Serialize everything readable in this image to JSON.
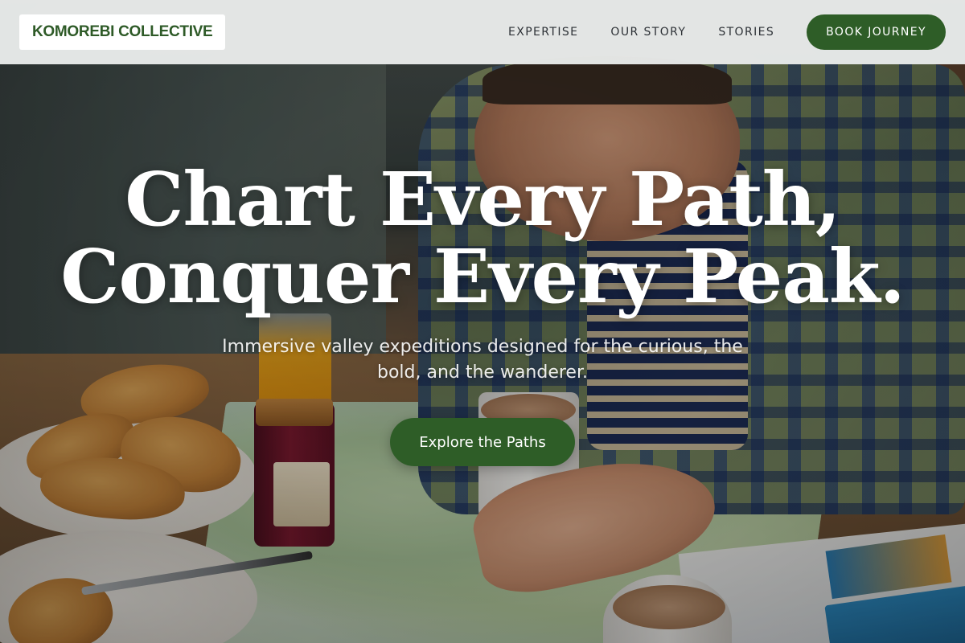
{
  "header": {
    "logo": "KOMOREBI COLLECTIVE",
    "nav": {
      "expertise": "EXPERTISE",
      "our_story": "OUR STORY",
      "stories": "STORIES"
    },
    "cta": "BOOK JOURNEY"
  },
  "hero": {
    "title_line1": "Chart Every Path,",
    "title_line2": "Conquer Every Peak.",
    "subtitle": "Immersive valley expeditions designed for the curious, the bold, and the wanderer.",
    "cta": "Explore the Paths"
  },
  "colors": {
    "brand_green": "#2e5d27",
    "logo_text": "#2e5a27",
    "header_bg": "#eef0ef"
  }
}
